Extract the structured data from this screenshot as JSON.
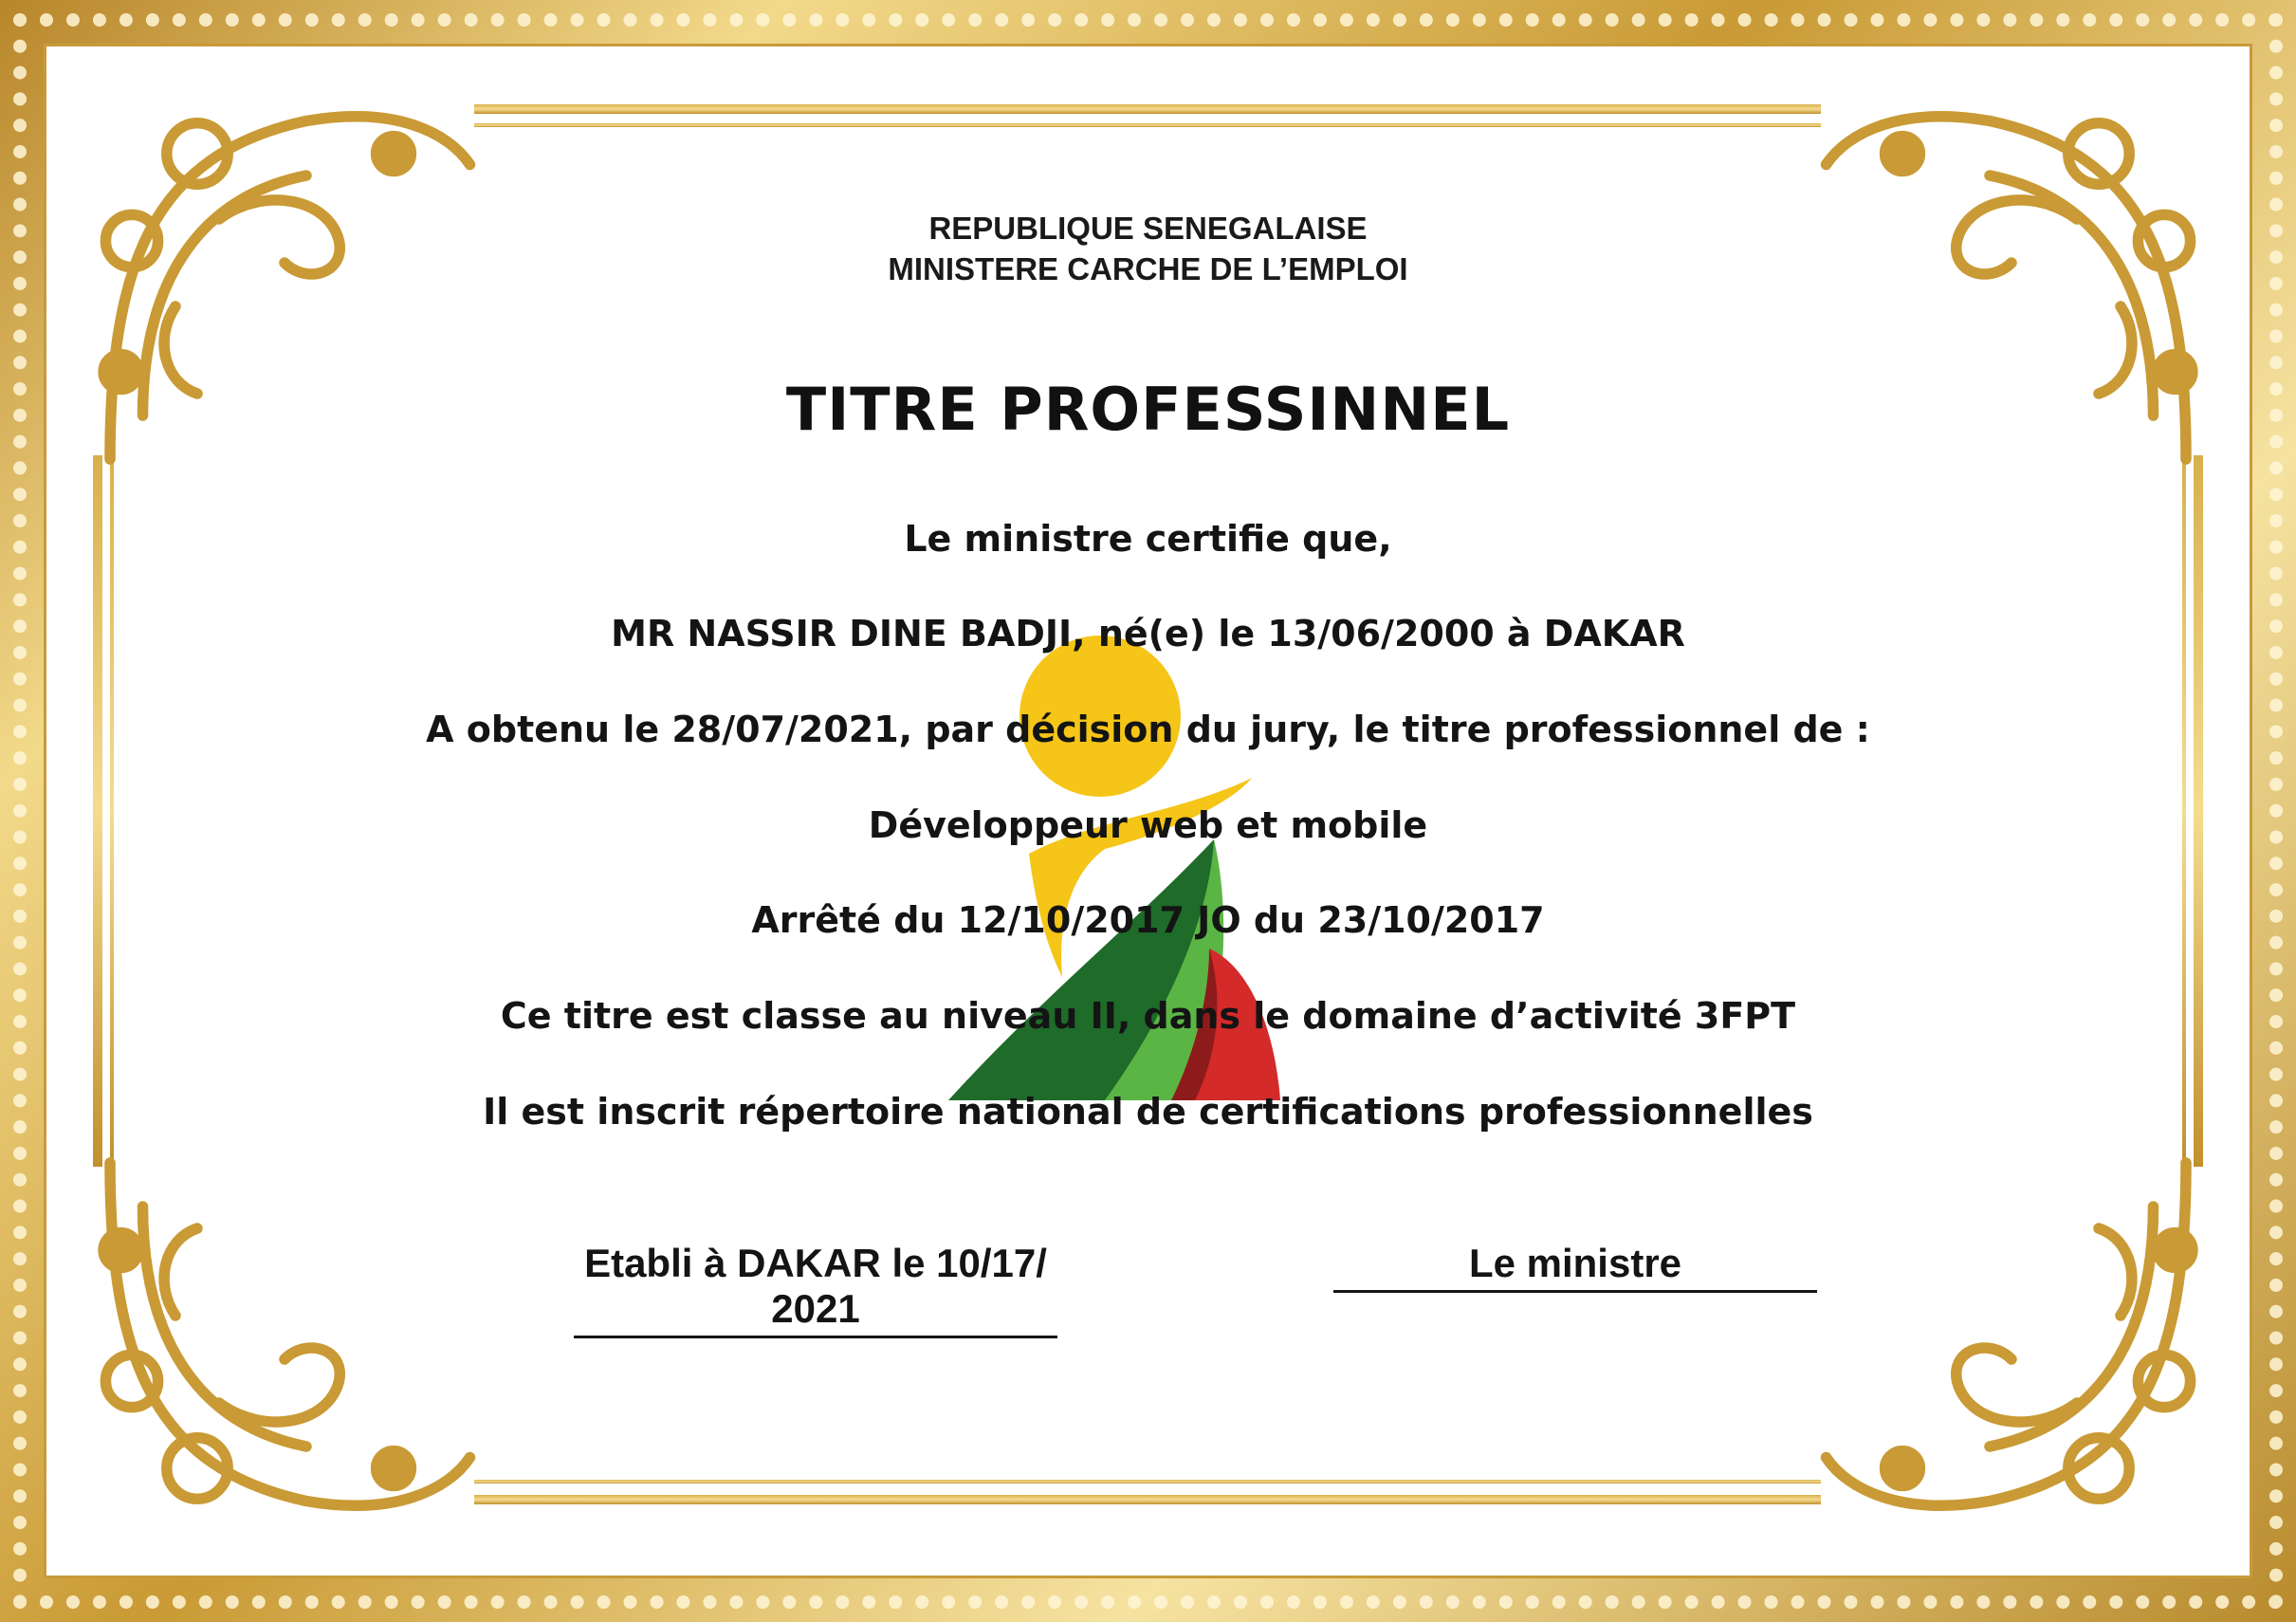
{
  "header": {
    "line1": "REPUBLIQUE SENEGALAISE",
    "line2": "MINISTERE CARCHE DE L’EMPLOI"
  },
  "title": "TITRE PROFESSINNEL",
  "body": {
    "intro": "Le ministre certifie que,",
    "holder": "MR NASSIR DINE BADJI, né(e) le 13/06/2000 à DAKAR",
    "obtained": "A obtenu le 28/07/2021, par décision du jury, le titre professionnel de :",
    "diploma": "Développeur  web et mobile",
    "decree": "Arrêté du 12/10/2017 JO du 23/10/2017",
    "level": "Ce titre est classe au niveau II, dans  le domaine d’activité 3FPT",
    "registry": "Il est inscrit répertoire national de certifications professionnelles"
  },
  "footer": {
    "place_date": "Etabli à DAKAR le 10/17/ 2021",
    "signatory": "Le ministre"
  },
  "colors": {
    "gold": "#c99a35",
    "logo_yellow": "#f5c518",
    "logo_dark_green": "#1e6b2a",
    "logo_light_green": "#5bb544",
    "logo_red": "#d42a2a"
  }
}
